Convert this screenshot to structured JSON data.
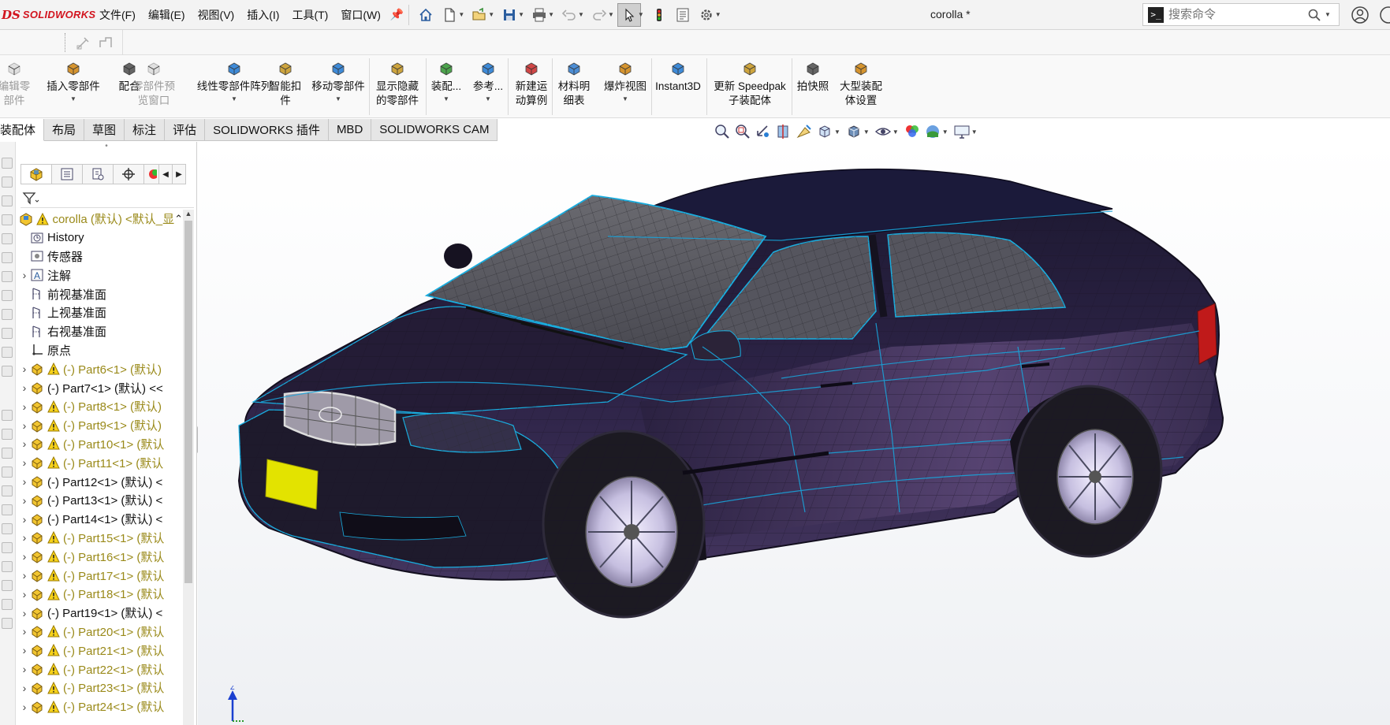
{
  "app": {
    "logo_ds": "DS",
    "logo_sw": "SOLIDWORKS",
    "doc_title": "corolla *"
  },
  "menus": [
    "文件(F)",
    "编辑(E)",
    "视图(V)",
    "插入(I)",
    "工具(T)",
    "窗口(W)"
  ],
  "search": {
    "placeholder": "搜索命令"
  },
  "commands": [
    {
      "label": "编辑零\n部件",
      "disabled": true
    },
    {
      "label": "插入零部件",
      "disabled": false
    },
    {
      "label": "配合",
      "disabled": false
    },
    {
      "label": "零部件预\n览窗口",
      "disabled": true
    },
    {
      "label": "线性零部件阵列",
      "disabled": false
    },
    {
      "label": "智能扣\n件",
      "disabled": false
    },
    {
      "label": "移动零部件",
      "disabled": false
    },
    {
      "label": "显示隐藏\n的零部件",
      "disabled": false
    },
    {
      "label": "装配...",
      "disabled": false
    },
    {
      "label": "参考...",
      "disabled": false
    },
    {
      "label": "新建运\n动算例",
      "disabled": false
    },
    {
      "label": "材料明\n细表",
      "disabled": false
    },
    {
      "label": "爆炸视图",
      "disabled": false
    },
    {
      "label": "Instant3D",
      "disabled": false
    },
    {
      "label": "更新 Speedpak\n子装配体",
      "disabled": false
    },
    {
      "label": "拍快照",
      "disabled": false
    },
    {
      "label": "大型装配\n体设置",
      "disabled": false
    }
  ],
  "tabs": [
    "装配体",
    "布局",
    "草图",
    "标注",
    "评估",
    "SOLIDWORKS 插件",
    "MBD",
    "SOLIDWORKS CAM"
  ],
  "active_tab": 0,
  "tree": [
    {
      "label": "corolla (默认) <默认_显",
      "type": "root",
      "warn": true
    },
    {
      "label": "History",
      "type": "history"
    },
    {
      "label": "传感器",
      "type": "sensor"
    },
    {
      "label": "注解",
      "type": "annotation",
      "expandable": true
    },
    {
      "label": "前视基准面",
      "type": "plane"
    },
    {
      "label": "上视基准面",
      "type": "plane"
    },
    {
      "label": "右视基准面",
      "type": "plane"
    },
    {
      "label": "原点",
      "type": "origin"
    },
    {
      "label": "(-) Part6<1> (默认)",
      "type": "part",
      "warn": true,
      "expandable": true
    },
    {
      "label": "(-) Part7<1> (默认) <<",
      "type": "part",
      "warn": false,
      "expandable": true
    },
    {
      "label": "(-) Part8<1> (默认)",
      "type": "part",
      "warn": true,
      "expandable": true
    },
    {
      "label": "(-) Part9<1> (默认)",
      "type": "part",
      "warn": true,
      "expandable": true
    },
    {
      "label": "(-) Part10<1> (默认",
      "type": "part",
      "warn": true,
      "expandable": true
    },
    {
      "label": "(-) Part11<1> (默认",
      "type": "part",
      "warn": true,
      "expandable": true
    },
    {
      "label": "(-) Part12<1> (默认) <",
      "type": "part",
      "warn": false,
      "expandable": true
    },
    {
      "label": "(-) Part13<1> (默认) <",
      "type": "part",
      "warn": false,
      "expandable": true
    },
    {
      "label": "(-) Part14<1> (默认) <",
      "type": "part",
      "warn": false,
      "expandable": true
    },
    {
      "label": "(-) Part15<1> (默认",
      "type": "part",
      "warn": true,
      "expandable": true
    },
    {
      "label": "(-) Part16<1> (默认",
      "type": "part",
      "warn": true,
      "expandable": true
    },
    {
      "label": "(-) Part17<1> (默认",
      "type": "part",
      "warn": true,
      "expandable": true
    },
    {
      "label": "(-) Part18<1> (默认",
      "type": "part",
      "warn": true,
      "expandable": true
    },
    {
      "label": "(-) Part19<1> (默认) <",
      "type": "part",
      "warn": false,
      "expandable": true
    },
    {
      "label": "(-) Part20<1> (默认",
      "type": "part",
      "warn": true,
      "expandable": true
    },
    {
      "label": "(-) Part21<1> (默认",
      "type": "part",
      "warn": true,
      "expandable": true
    },
    {
      "label": "(-) Part22<1> (默认",
      "type": "part",
      "warn": true,
      "expandable": true
    },
    {
      "label": "(-) Part23<1> (默认",
      "type": "part",
      "warn": true,
      "expandable": true
    },
    {
      "label": "(-) Part24<1> (默认",
      "type": "part",
      "warn": true,
      "expandable": true
    }
  ],
  "triad": {
    "z_label": "Z"
  },
  "colors": {
    "brand": "#d2141e",
    "car_body": "#2a1f3d",
    "mesh_edge": "#1aa3d9",
    "plate": "#e3e300",
    "warned_text": "#9a8a1a"
  }
}
